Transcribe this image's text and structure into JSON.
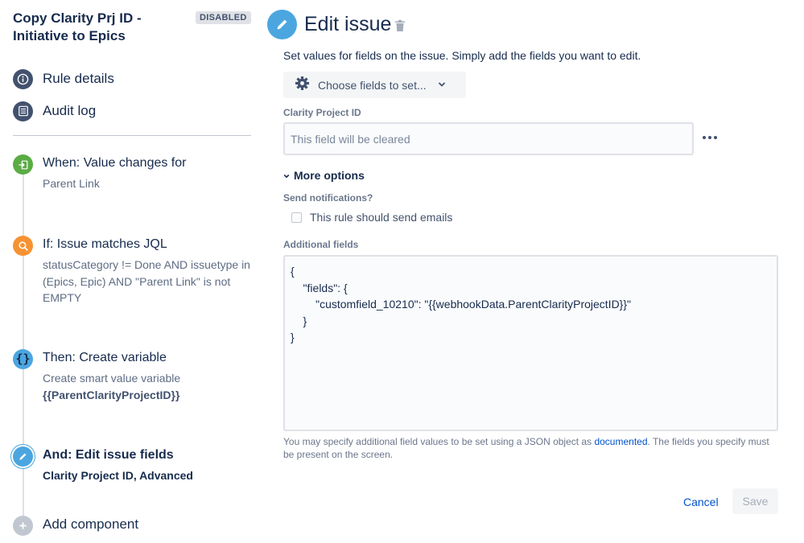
{
  "rule": {
    "title": "Copy Clarity Prj ID - Initiative to Epics",
    "status_badge": "DISABLED"
  },
  "nav": {
    "rule_details": "Rule details",
    "audit_log": "Audit log"
  },
  "components": [
    {
      "title": "When: Value changes for",
      "desc": "Parent Link",
      "icon": "trigger-icon",
      "color": "#5aac44"
    },
    {
      "title": "If: Issue matches JQL",
      "desc": "statusCategory != Done AND issuetype in (Epics, Epic) AND \"Parent Link\" is not EMPTY",
      "icon": "search-icon",
      "color": "#f79232"
    },
    {
      "title": "Then: Create variable",
      "desc": "Create smart value variable",
      "desc_strong": "{{ParentClarityProjectID}}",
      "icon": "braces-icon",
      "color": "#4ba6e0"
    },
    {
      "title": "And: Edit issue fields",
      "desc": "Clarity Project ID, Advanced",
      "icon": "pencil-icon",
      "color": "#4ba6e0"
    },
    {
      "title": "Add component",
      "icon": "plus-icon",
      "color": "#c1c7d0"
    }
  ],
  "editor": {
    "title": "Edit issue",
    "instructions": "Set values for fields on the issue. Simply add the fields you want to edit.",
    "choose_fields_label": "Choose fields to set...",
    "field_label": "Clarity Project ID",
    "field_placeholder": "This field will be cleared",
    "more_options_label": "More options",
    "send_notifications_label": "Send notifications?",
    "send_emails_label": "This rule should send emails",
    "additional_fields_label": "Additional fields",
    "additional_fields_value": "{\n    \"fields\": {\n        \"customfield_10210\": \"{{webhookData.ParentClarityProjectID}}\"\n    }\n}",
    "help_text_before": "You may specify additional field values to be set using a JSON object as ",
    "help_link": "documented",
    "help_text_after": ". The fields you specify must be present on the screen.",
    "cancel_label": "Cancel",
    "save_label": "Save"
  },
  "colors": {
    "link": "#0052cc",
    "nav_icon": "#42526e",
    "editor_icon": "#4ba6e0"
  }
}
